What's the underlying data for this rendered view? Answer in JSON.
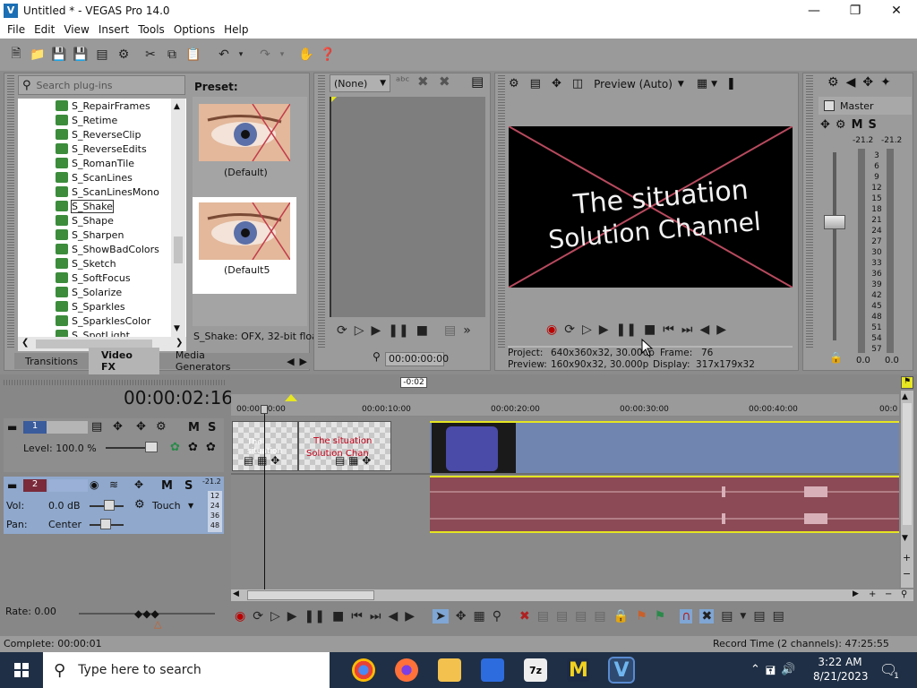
{
  "window": {
    "title": "Untitled * - VEGAS Pro 14.0"
  },
  "menu": [
    "File",
    "Edit",
    "View",
    "Insert",
    "Tools",
    "Options",
    "Help"
  ],
  "plugins": {
    "search_placeholder": "Search plug-ins",
    "items": [
      "S_RepairFrames",
      "S_Retime",
      "S_ReverseClip",
      "S_ReverseEdits",
      "S_RomanTile",
      "S_ScanLines",
      "S_ScanLinesMono",
      "S_Shake",
      "S_Shape",
      "S_Sharpen",
      "S_ShowBadColors",
      "S_Sketch",
      "S_SoftFocus",
      "S_Solarize",
      "S_Sparkles",
      "S_SparklesColor",
      "S_SpotLight"
    ],
    "selected": "S_Shake",
    "preset_label": "Preset:",
    "presets": [
      "(Default)",
      "(Default5"
    ],
    "info": "S_Shake: OFX, 32-bit floa",
    "tabs": [
      "Transitions",
      "Video FX",
      "Media Generators"
    ]
  },
  "trimmer": {
    "dropdown": "(None)",
    "time": "00:00:00:00"
  },
  "preview": {
    "mode": "Preview (Auto)",
    "overlay_line1": "The situation",
    "overlay_line2": "Solution Channel",
    "project_label": "Project:",
    "project_value": "640x360x32, 30.000p",
    "frame_label": "Frame:",
    "frame_value": "76",
    "preview_label": "Preview:",
    "preview_value": "160x90x32, 30.000p",
    "display_label": "Display:",
    "display_value": "317x179x32"
  },
  "mixer": {
    "title": "Master",
    "peak_left": "-21.2",
    "peak_right": "-21.2",
    "scale": [
      "3",
      "6",
      "9",
      "12",
      "15",
      "18",
      "21",
      "24",
      "27",
      "30",
      "33",
      "36",
      "39",
      "42",
      "45",
      "48",
      "51",
      "54",
      "57"
    ],
    "level_left": "0.0",
    "level_right": "0.0"
  },
  "timeline": {
    "timecode": "00:00:02:16",
    "marker": "-0:02",
    "ruler": [
      "00:00:00:00",
      "00:00:10:00",
      "00:00:20:00",
      "00:00:30:00",
      "00:00:40:00",
      "00:0"
    ],
    "track1": {
      "num": "1",
      "level": "Level: 100.0 %"
    },
    "track2": {
      "num": "2",
      "vol_label": "Vol:",
      "vol": "0.0 dB",
      "pan_label": "Pan:",
      "pan": "Center",
      "touch": "Touch",
      "meter_top": "-21.2",
      "meter_ticks": [
        "12",
        "24",
        "36",
        "48"
      ]
    },
    "clip_text1": "The situation",
    "clip_text2": "Solution Chan"
  },
  "rate": "Rate: 0.00",
  "status": {
    "complete": "Complete: 00:00:01",
    "record": "Record Time (2 channels): 47:25:55"
  },
  "taskbar": {
    "search": "Type here to search",
    "time": "3:22 AM",
    "date": "8/21/2023",
    "notif": "1"
  }
}
